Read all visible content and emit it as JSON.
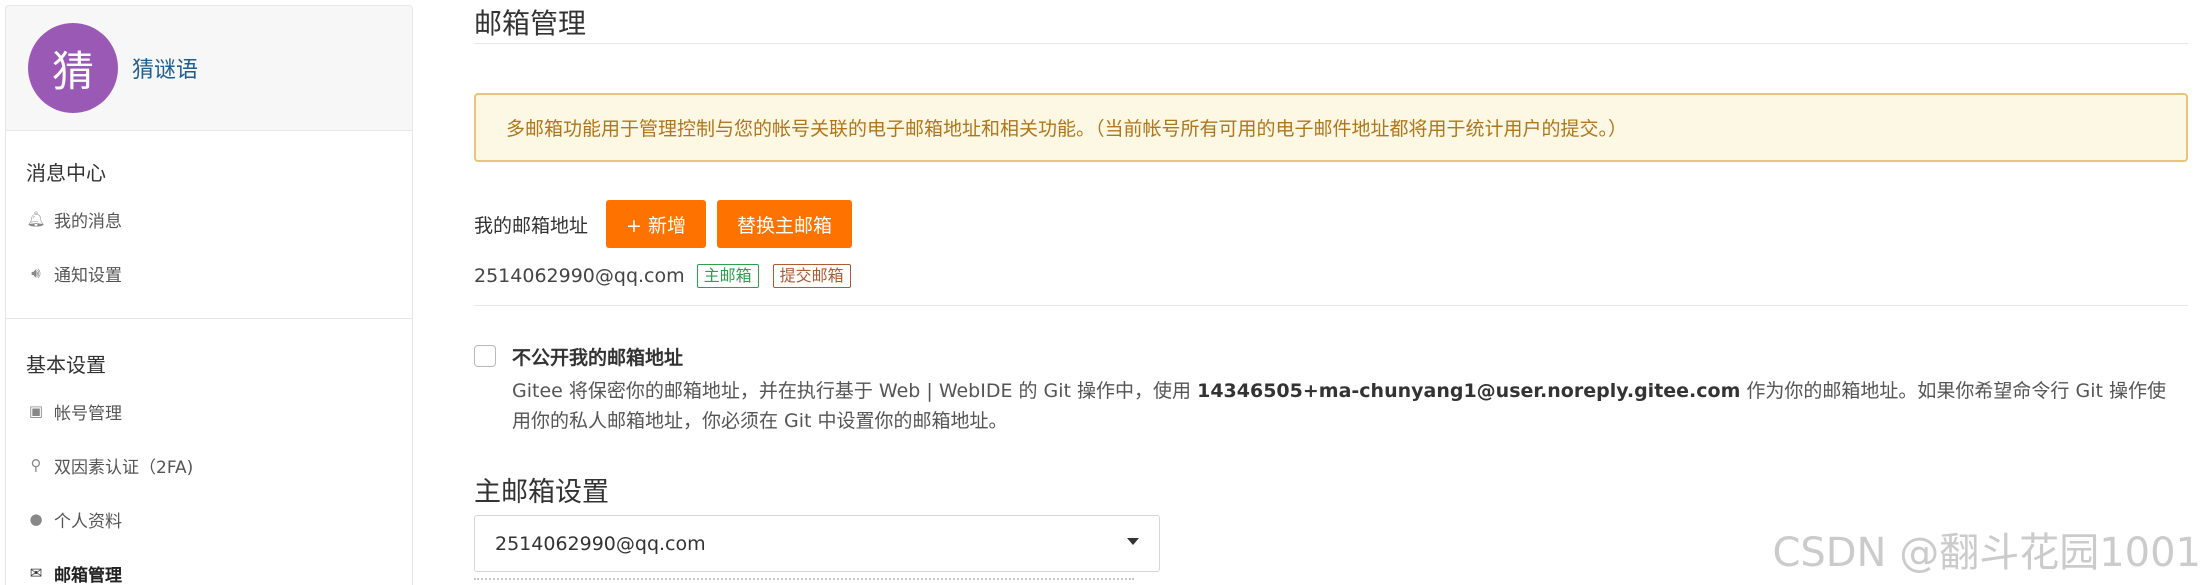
{
  "sidebar": {
    "avatar_char": "猜",
    "avatar_color": "#9b59b6",
    "username": "猜谜语",
    "sections": [
      {
        "title": "消息中心",
        "items": [
          {
            "icon": "bell-icon",
            "label": "我的消息"
          },
          {
            "icon": "speaker-icon",
            "label": "通知设置"
          }
        ]
      },
      {
        "title": "基本设置",
        "items": [
          {
            "icon": "id-card-icon",
            "label": "帐号管理"
          },
          {
            "icon": "user-key-icon",
            "label": "双因素认证（2FA)"
          },
          {
            "icon": "user-icon",
            "label": "个人资料"
          },
          {
            "icon": "envelope-icon",
            "label": "邮箱管理",
            "active": true
          }
        ]
      }
    ]
  },
  "main": {
    "title": "邮箱管理",
    "notice": "多邮箱功能用于管理控制与您的帐号关联的电子邮箱地址和相关功能。（当前帐号所有可用的电子邮件地址都将用于统计用户的提交。）",
    "my_emails_label": "我的邮箱地址",
    "add_button": "+ 新增",
    "switch_button": "替换主邮箱",
    "email_address": "2514062990@qq.com",
    "badge_primary": "主邮箱",
    "badge_commit": "提交邮箱",
    "private_title": "不公开我的邮箱地址",
    "private_desc_before": "Gitee 将保密你的邮箱地址，并在执行基于 Web | WebIDE 的 Git 操作中，使用 ",
    "private_desc_noreply": "14346505+ma-chunyang1@user.noreply.gitee.com",
    "private_desc_after": " 作为你的邮箱地址。如果你希望命令行 Git 操作使用你的私人邮箱地址，你必须在 Git 中设置你的邮箱地址。",
    "primary_title": "主邮箱设置",
    "primary_select_value": "2514062990@qq.com"
  },
  "watermark": "CSDN @翻斗花园1001",
  "colors": {
    "accent": "#fe7300",
    "notice_bg": "#fcf8e3",
    "notice_text": "#b0761c",
    "badge_primary": "#2aa14a",
    "badge_commit": "#b05a32"
  }
}
